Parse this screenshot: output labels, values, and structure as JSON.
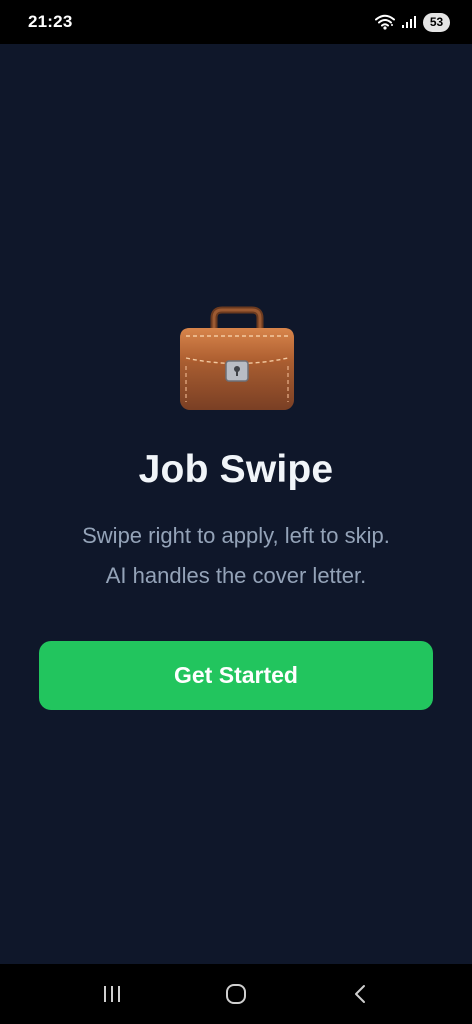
{
  "status_bar": {
    "time": "21:23",
    "battery_level": "53",
    "icons": [
      "wifi-icon",
      "signal-icon",
      "battery-icon"
    ]
  },
  "main": {
    "logo_icon": "briefcase-icon",
    "title": "Job Swipe",
    "subtitle_line1": "Swipe right to apply, left to skip.",
    "subtitle_line2": "AI handles the cover letter.",
    "cta_label": "Get Started"
  },
  "nav_bar": {
    "buttons": [
      "recent-apps-icon",
      "home-icon",
      "back-icon"
    ]
  },
  "colors": {
    "background": "#0f172a",
    "accent": "#22c55e",
    "title": "#f1f5f9",
    "subtitle": "#94a3b8"
  }
}
